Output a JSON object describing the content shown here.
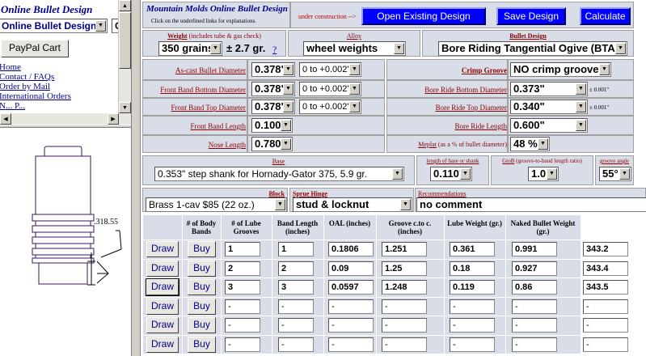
{
  "left_frame": {
    "title": "Online Bullet Design",
    "nav_select": "Online Bullet Design",
    "nav_select_extra": "G",
    "paypal_button": "PayPal Cart",
    "links": [
      "Home",
      "Contact / FAQs",
      "Order by Mail",
      "International Orders",
      "N... P..."
    ],
    "drawing_label": ".318.55"
  },
  "header": {
    "title": "Mountain Molds Online Bullet Design",
    "subtitle": "Click on the underlined links for explanations.",
    "construction": "under construction -->",
    "open_button": "Open Existing Design",
    "save_button": "Save Design",
    "calculate_button": "Calculate"
  },
  "weight": {
    "label": "Weight",
    "note": "(includes tube & gas check)",
    "value": "350 grains",
    "tolerance": "± 2.7 gr.",
    "help": "?"
  },
  "alloy": {
    "label": "Alloy",
    "value": "wheel weights"
  },
  "bullet_design": {
    "label": "Bullet Design",
    "value": "Bore Riding Tangential Ogive (BTAN)"
  },
  "left_params": [
    {
      "label": "As-cast Bullet Diameter",
      "value": "0.378\"",
      "tolerance": "0 to +0.002\""
    },
    {
      "label": "Front Band Bottom Diameter",
      "value": "0.378\"",
      "tolerance": "0 to +0.002\""
    },
    {
      "label": "Front Band Top Diameter",
      "value": "0.378\"",
      "tolerance": "0 to +0.002\""
    },
    {
      "label": "Front Band Length",
      "value": "0.100\""
    },
    {
      "label": "Nose Length",
      "value": "0.780\""
    }
  ],
  "right_params": [
    {
      "label": "Crimp Groove",
      "value": "NO crimp groove"
    },
    {
      "label": "Bore Ride Bottom Diameter",
      "value": "0.373\"",
      "tolerance": "± 0.001\""
    },
    {
      "label": "Bore Ride Top Diameter",
      "value": "0.340\"",
      "tolerance": "± 0.001\""
    },
    {
      "label": "Bore Ride Length",
      "value": "0.600\""
    },
    {
      "label": "Meplat",
      "note": "(as a % of bullet diameter)",
      "value": "48 %"
    }
  ],
  "base": {
    "label": "Base",
    "value": "0.353\" step shank for Hornady-Gator 375, 5.9 gr."
  },
  "shank_length": {
    "label": "length of base or shank",
    "value": "0.110\""
  },
  "gtob": {
    "label": "GtoB",
    "note": "(groove-to-band length ratio)",
    "value": "1.0"
  },
  "groove_angle": {
    "label": "groove angle",
    "value": "55°"
  },
  "block": {
    "label": "Block",
    "value": "Brass 1-cav $85 (22 oz.)"
  },
  "sprue": {
    "label": "Sprue Hinge",
    "value": "stud & locknut"
  },
  "recommendations": {
    "label": "Recommendations",
    "value": "no comment"
  },
  "table": {
    "headers": [
      "# of Body Bands",
      "# of Lube Grooves",
      "Band Length (inches)",
      "OAL (inches)",
      "Groove c.to c. (inches)",
      "Lube Weight (gr.)",
      "Naked Bullet Weight (gr.)"
    ],
    "draw_label": "Draw",
    "buy_label": "Buy",
    "rows": [
      [
        "1",
        "1",
        "0.1806",
        "1.251",
        "0.361",
        "0.991",
        "343.2"
      ],
      [
        "2",
        "2",
        "0.09",
        "1.25",
        "0.18",
        "0.927",
        "343.4"
      ],
      [
        "3",
        "3",
        "0.0597",
        "1.248",
        "0.119",
        "0.86",
        "343.5"
      ],
      [
        "-",
        "-",
        "-",
        "-",
        "-",
        "-",
        "-"
      ],
      [
        "-",
        "-",
        "-",
        "-",
        "-",
        "-",
        "-"
      ],
      [
        "-",
        "-",
        "-",
        "-",
        "-",
        "-",
        "-"
      ]
    ]
  },
  "colors": {
    "panel": "#d8dde8",
    "button_blue": "#0000ff",
    "label_red": "#8b0000",
    "link_blue": "#00008b"
  }
}
